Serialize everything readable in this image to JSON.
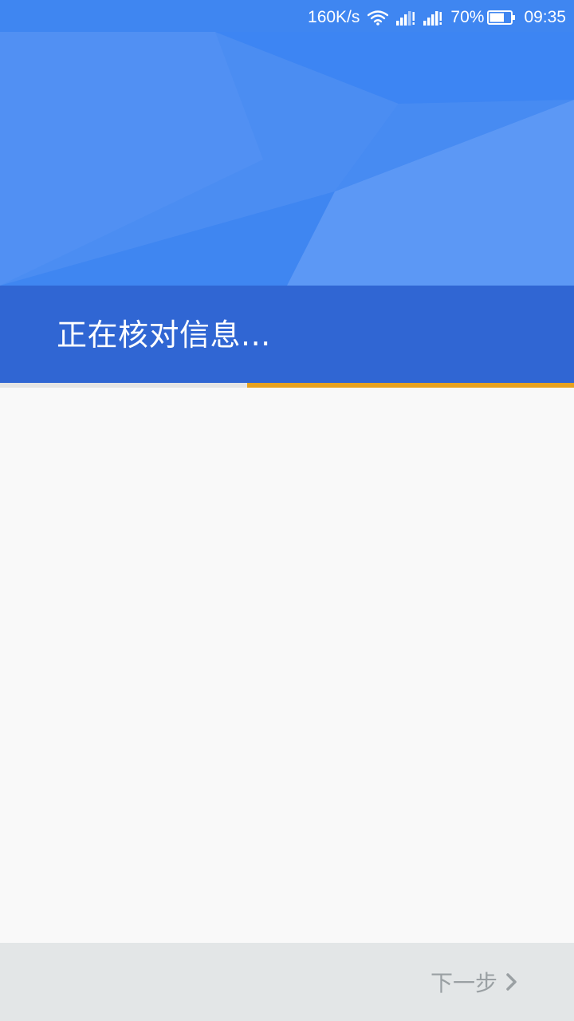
{
  "status_bar": {
    "net_speed": "160K/s",
    "battery_percent": "70%",
    "time": "09:35",
    "battery_level": 0.7,
    "icons": [
      "wifi-icon",
      "signal-icon-sim1",
      "signal-icon-sim2",
      "battery-icon"
    ]
  },
  "header": {
    "title": "正在核对信息..."
  },
  "progress": {
    "fraction_pending": 0.57
  },
  "bottom_bar": {
    "next_label": "下一步",
    "next_icon": "chevron-right-icon"
  },
  "colors": {
    "primary": "#3f86f1",
    "title_band": "#3066d3",
    "progress_accent": "#e7a21e",
    "bottom_bar_bg": "#e3e6e7",
    "disabled_text": "#9aa0a3"
  }
}
